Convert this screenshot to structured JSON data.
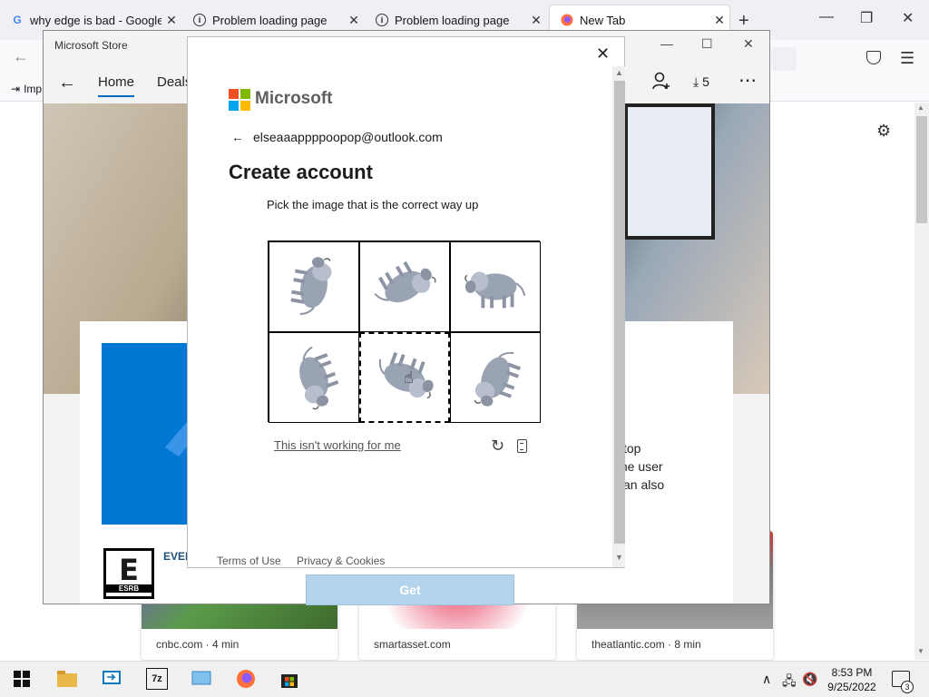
{
  "browser": {
    "tabs": [
      {
        "title": "why edge is bad - Google S",
        "icon": "google-icon"
      },
      {
        "title": "Problem loading page",
        "icon": "info-icon"
      },
      {
        "title": "Problem loading page",
        "icon": "info-icon"
      },
      {
        "title": "New Tab",
        "icon": "firefox-icon"
      }
    ],
    "import_label": "Imp"
  },
  "store": {
    "window_title": "Microsoft Store",
    "nav": {
      "home": "Home",
      "deals": "Deals"
    },
    "download_count": "5",
    "panel": {
      "esrb_rating": "E",
      "esrb_label": "ESRB",
      "rating_text": "EVER",
      "desc_lines": [
        "ktop",
        "the user",
        "can also"
      ]
    },
    "get_label": "Get"
  },
  "dialog": {
    "brand": "Microsoft",
    "email": "elseaaappppoopop@outlook.com",
    "heading": "Create account",
    "instruction": "Pick the image that is the correct way up",
    "not_working": "This isn't working for me",
    "footer": {
      "terms": "Terms of Use",
      "privacy": "Privacy & Cookies"
    },
    "images": [
      {
        "rotation": 100,
        "selected": false
      },
      {
        "rotation": 150,
        "selected": false
      },
      {
        "rotation": 0,
        "selected": false
      },
      {
        "rotation": 250,
        "selected": false
      },
      {
        "rotation": 200,
        "selected": true
      },
      {
        "rotation": 290,
        "selected": false
      }
    ]
  },
  "news": [
    {
      "source": "cnbc.com · 4 min"
    },
    {
      "source": "smartasset.com"
    },
    {
      "source": "theatlantic.com · 8 min"
    }
  ],
  "taskbar": {
    "time": "8:53 PM",
    "date": "9/25/2022",
    "notification_count": "3"
  },
  "colors": {
    "accent_blue": "#0078d4",
    "ms_red": "#f25022",
    "ms_green": "#7fba00",
    "ms_blue": "#00a4ef",
    "ms_yellow": "#ffb900"
  }
}
